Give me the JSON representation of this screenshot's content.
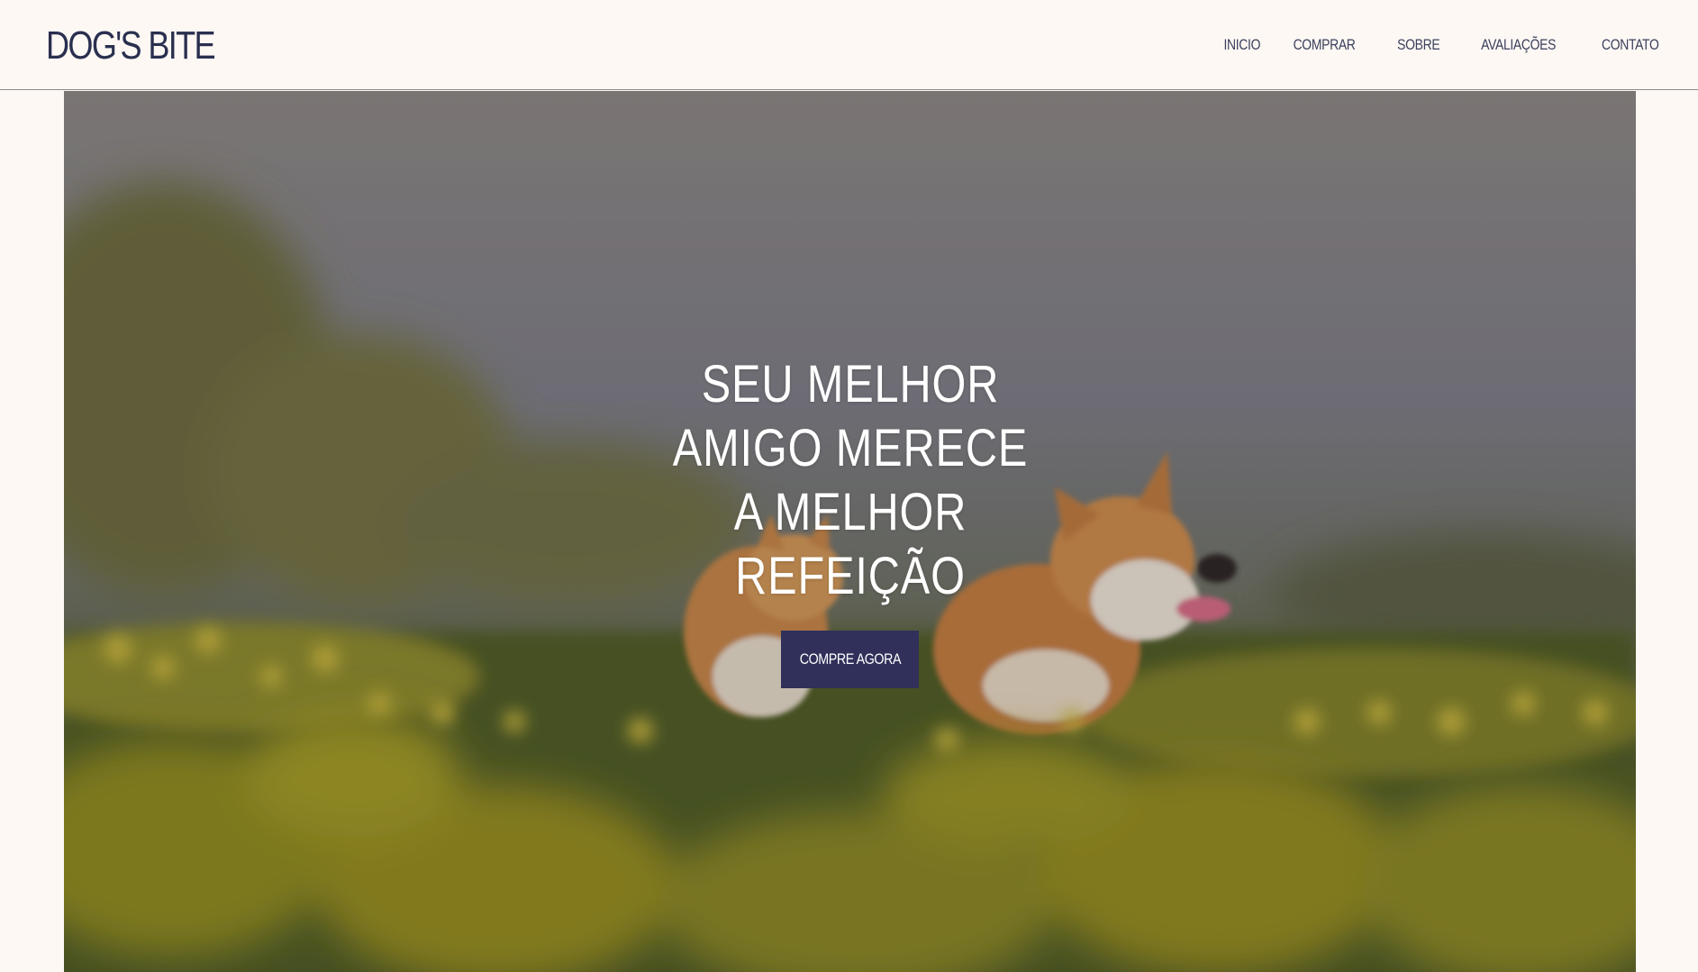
{
  "header": {
    "logo": "DOG'S BITE",
    "nav": [
      {
        "label": "INICIO"
      },
      {
        "label": "COMPRAR"
      },
      {
        "label": "SOBRE"
      },
      {
        "label": "AVALIAÇÕES"
      },
      {
        "label": "CONTATO"
      }
    ]
  },
  "hero": {
    "title": "SEU MELHOR AMIGO MERECE A MELHOR REFEIÇÃO",
    "cta_label": "COMPRE AGORA",
    "image": "cat-and-corgi-in-yellow-flower-field"
  },
  "colors": {
    "page_background": "#fdf8f4",
    "brand_text": "#2a2f4f",
    "cta_background": "#30305a",
    "hero_text": "#ffffff"
  }
}
